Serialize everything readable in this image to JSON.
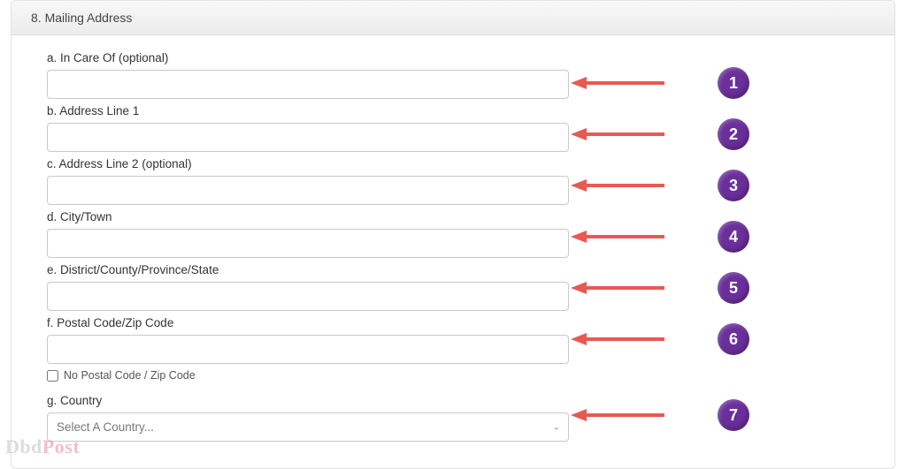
{
  "section": {
    "heading": "8. Mailing Address"
  },
  "fields": {
    "a": {
      "label": "a. In Care Of (optional)",
      "value": ""
    },
    "b": {
      "label": "b. Address Line 1",
      "value": ""
    },
    "c": {
      "label": "c. Address Line 2 (optional)",
      "value": ""
    },
    "d": {
      "label": "d. City/Town",
      "value": ""
    },
    "e": {
      "label": "e. District/County/Province/State",
      "value": ""
    },
    "f": {
      "label": "f. Postal Code/Zip Code",
      "value": ""
    },
    "no_postal": {
      "label": "No Postal Code / Zip Code",
      "checked": false
    },
    "g": {
      "label": "g. Country",
      "selected": "Select A Country..."
    }
  },
  "annotations": [
    {
      "n": "1"
    },
    {
      "n": "2"
    },
    {
      "n": "3"
    },
    {
      "n": "4"
    },
    {
      "n": "5"
    },
    {
      "n": "6"
    },
    {
      "n": "7"
    }
  ],
  "watermark": {
    "part1": "Dbd",
    "part2": "Post"
  },
  "colors": {
    "badge": "#6b2f9c",
    "arrow": "#e75a52"
  }
}
